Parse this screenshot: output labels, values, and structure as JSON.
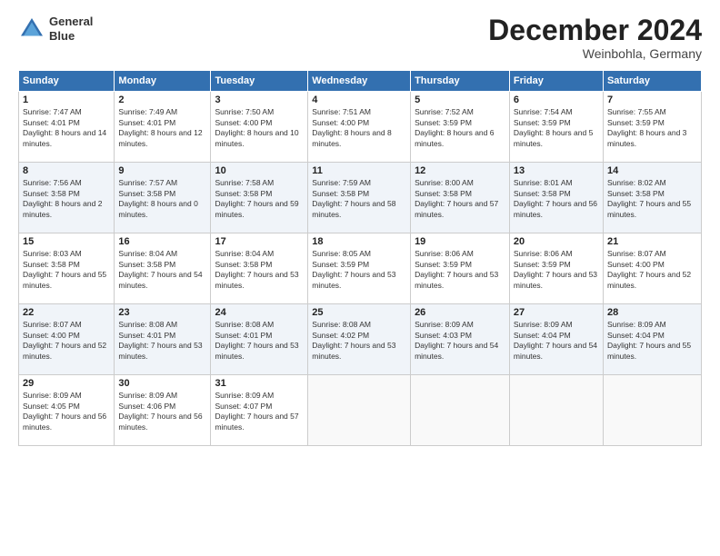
{
  "header": {
    "logo_line1": "General",
    "logo_line2": "Blue",
    "month": "December 2024",
    "location": "Weinbohla, Germany"
  },
  "days_of_week": [
    "Sunday",
    "Monday",
    "Tuesday",
    "Wednesday",
    "Thursday",
    "Friday",
    "Saturday"
  ],
  "weeks": [
    [
      {
        "day": 1,
        "rise": "7:47 AM",
        "set": "4:01 PM",
        "daylight": "8 hours and 14 minutes."
      },
      {
        "day": 2,
        "rise": "7:49 AM",
        "set": "4:01 PM",
        "daylight": "8 hours and 12 minutes."
      },
      {
        "day": 3,
        "rise": "7:50 AM",
        "set": "4:00 PM",
        "daylight": "8 hours and 10 minutes."
      },
      {
        "day": 4,
        "rise": "7:51 AM",
        "set": "4:00 PM",
        "daylight": "8 hours and 8 minutes."
      },
      {
        "day": 5,
        "rise": "7:52 AM",
        "set": "3:59 PM",
        "daylight": "8 hours and 6 minutes."
      },
      {
        "day": 6,
        "rise": "7:54 AM",
        "set": "3:59 PM",
        "daylight": "8 hours and 5 minutes."
      },
      {
        "day": 7,
        "rise": "7:55 AM",
        "set": "3:59 PM",
        "daylight": "8 hours and 3 minutes."
      }
    ],
    [
      {
        "day": 8,
        "rise": "7:56 AM",
        "set": "3:58 PM",
        "daylight": "8 hours and 2 minutes."
      },
      {
        "day": 9,
        "rise": "7:57 AM",
        "set": "3:58 PM",
        "daylight": "8 hours and 0 minutes."
      },
      {
        "day": 10,
        "rise": "7:58 AM",
        "set": "3:58 PM",
        "daylight": "7 hours and 59 minutes."
      },
      {
        "day": 11,
        "rise": "7:59 AM",
        "set": "3:58 PM",
        "daylight": "7 hours and 58 minutes."
      },
      {
        "day": 12,
        "rise": "8:00 AM",
        "set": "3:58 PM",
        "daylight": "7 hours and 57 minutes."
      },
      {
        "day": 13,
        "rise": "8:01 AM",
        "set": "3:58 PM",
        "daylight": "7 hours and 56 minutes."
      },
      {
        "day": 14,
        "rise": "8:02 AM",
        "set": "3:58 PM",
        "daylight": "7 hours and 55 minutes."
      }
    ],
    [
      {
        "day": 15,
        "rise": "8:03 AM",
        "set": "3:58 PM",
        "daylight": "7 hours and 55 minutes."
      },
      {
        "day": 16,
        "rise": "8:04 AM",
        "set": "3:58 PM",
        "daylight": "7 hours and 54 minutes."
      },
      {
        "day": 17,
        "rise": "8:04 AM",
        "set": "3:58 PM",
        "daylight": "7 hours and 53 minutes."
      },
      {
        "day": 18,
        "rise": "8:05 AM",
        "set": "3:59 PM",
        "daylight": "7 hours and 53 minutes."
      },
      {
        "day": 19,
        "rise": "8:06 AM",
        "set": "3:59 PM",
        "daylight": "7 hours and 53 minutes."
      },
      {
        "day": 20,
        "rise": "8:06 AM",
        "set": "3:59 PM",
        "daylight": "7 hours and 53 minutes."
      },
      {
        "day": 21,
        "rise": "8:07 AM",
        "set": "4:00 PM",
        "daylight": "7 hours and 52 minutes."
      }
    ],
    [
      {
        "day": 22,
        "rise": "8:07 AM",
        "set": "4:00 PM",
        "daylight": "7 hours and 52 minutes."
      },
      {
        "day": 23,
        "rise": "8:08 AM",
        "set": "4:01 PM",
        "daylight": "7 hours and 53 minutes."
      },
      {
        "day": 24,
        "rise": "8:08 AM",
        "set": "4:01 PM",
        "daylight": "7 hours and 53 minutes."
      },
      {
        "day": 25,
        "rise": "8:08 AM",
        "set": "4:02 PM",
        "daylight": "7 hours and 53 minutes."
      },
      {
        "day": 26,
        "rise": "8:09 AM",
        "set": "4:03 PM",
        "daylight": "7 hours and 54 minutes."
      },
      {
        "day": 27,
        "rise": "8:09 AM",
        "set": "4:04 PM",
        "daylight": "7 hours and 54 minutes."
      },
      {
        "day": 28,
        "rise": "8:09 AM",
        "set": "4:04 PM",
        "daylight": "7 hours and 55 minutes."
      }
    ],
    [
      {
        "day": 29,
        "rise": "8:09 AM",
        "set": "4:05 PM",
        "daylight": "7 hours and 56 minutes."
      },
      {
        "day": 30,
        "rise": "8:09 AM",
        "set": "4:06 PM",
        "daylight": "7 hours and 56 minutes."
      },
      {
        "day": 31,
        "rise": "8:09 AM",
        "set": "4:07 PM",
        "daylight": "7 hours and 57 minutes."
      },
      null,
      null,
      null,
      null
    ]
  ]
}
